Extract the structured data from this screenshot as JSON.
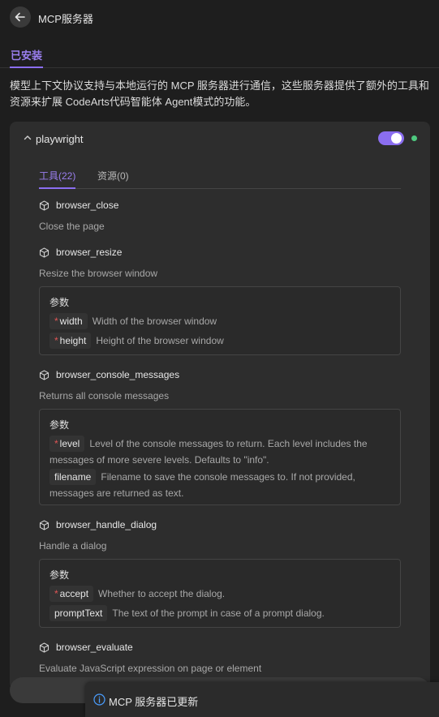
{
  "header": {
    "title": "MCP服务器"
  },
  "tabs": {
    "installed": "已安装"
  },
  "description": "模型上下文协议支持与本地运行的 MCP 服务器进行通信，这些服务器提供了额外的工具和资源来扩展 CodeArts代码智能体 Agent模式的功能。",
  "server": {
    "name": "playwright",
    "enabled": true,
    "status_color": "#4ec97f",
    "subtabs": {
      "tools": "工具(22)",
      "resources": "资源(0)"
    },
    "params_label": "参数",
    "tools": [
      {
        "name": "browser_close",
        "desc": "Close the page"
      },
      {
        "name": "browser_resize",
        "desc": "Resize the browser window",
        "params": [
          {
            "name": "width",
            "required": "*",
            "desc": "Width of the browser window"
          },
          {
            "name": "height",
            "required": "*",
            "desc": "Height of the browser window"
          }
        ]
      },
      {
        "name": "browser_console_messages",
        "desc": "Returns all console messages",
        "params": [
          {
            "name": "level",
            "required": "*",
            "desc": "Level of the console messages to return. Each level includes the messages of more severe levels. Defaults to \"info\"."
          },
          {
            "name": "filename",
            "required": "",
            "desc": "Filename to save the console messages to. If not provided, messages are returned as text."
          }
        ]
      },
      {
        "name": "browser_handle_dialog",
        "desc": "Handle a dialog",
        "params": [
          {
            "name": "accept",
            "required": "*",
            "desc": "Whether to accept the dialog."
          },
          {
            "name": "promptText",
            "required": "",
            "desc": "The text of the prompt in case of a prompt dialog."
          }
        ]
      },
      {
        "name": "browser_evaluate",
        "desc": "Evaluate JavaScript expression on page or element"
      }
    ]
  },
  "toast": {
    "text": "MCP 服务器已更新"
  },
  "colors": {
    "accent": "#8b6ef0",
    "background": "#1e1e1e",
    "card": "#2d2d2d"
  }
}
